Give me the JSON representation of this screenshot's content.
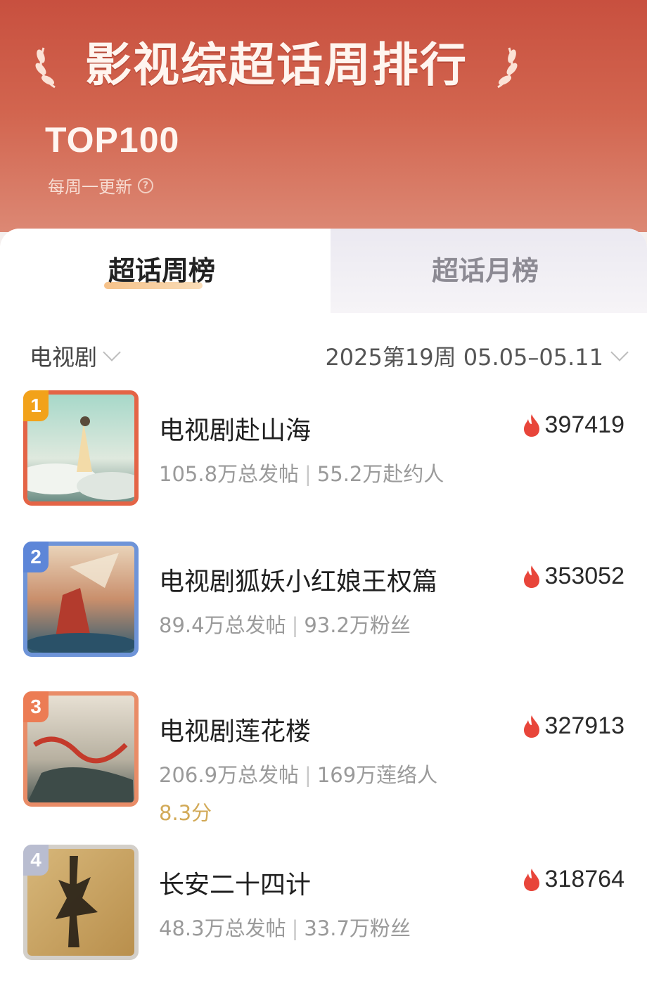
{
  "header": {
    "title": "影视综超话周排行",
    "subtitle": "TOP100",
    "update_text": "每周一更新",
    "help_icon": "question-circle-icon"
  },
  "tabs": [
    {
      "label": "超话周榜",
      "active": true
    },
    {
      "label": "超话月榜",
      "active": false
    }
  ],
  "filter": {
    "category": "电视剧",
    "week_label": "2025第19周 05.05–05.11"
  },
  "colors": {
    "header_red": "#c8503f",
    "accent_gold": "#f6c28a",
    "fire": "#e8453a"
  },
  "items": [
    {
      "rank": "1",
      "title": "电视剧赴山海",
      "posts": "105.8万总发帖",
      "fans": "55.2万赴约人",
      "score": "",
      "heat": "397419"
    },
    {
      "rank": "2",
      "title": "电视剧狐妖小红娘王权篇",
      "posts": "89.4万总发帖",
      "fans": "93.2万粉丝",
      "score": "",
      "heat": "353052"
    },
    {
      "rank": "3",
      "title": "电视剧莲花楼",
      "posts": "206.9万总发帖",
      "fans": "169万莲络人",
      "score": "8.3分",
      "heat": "327913"
    },
    {
      "rank": "4",
      "title": "长安二十四计",
      "posts": "48.3万总发帖",
      "fans": "33.7万粉丝",
      "score": "",
      "heat": "318764"
    }
  ]
}
